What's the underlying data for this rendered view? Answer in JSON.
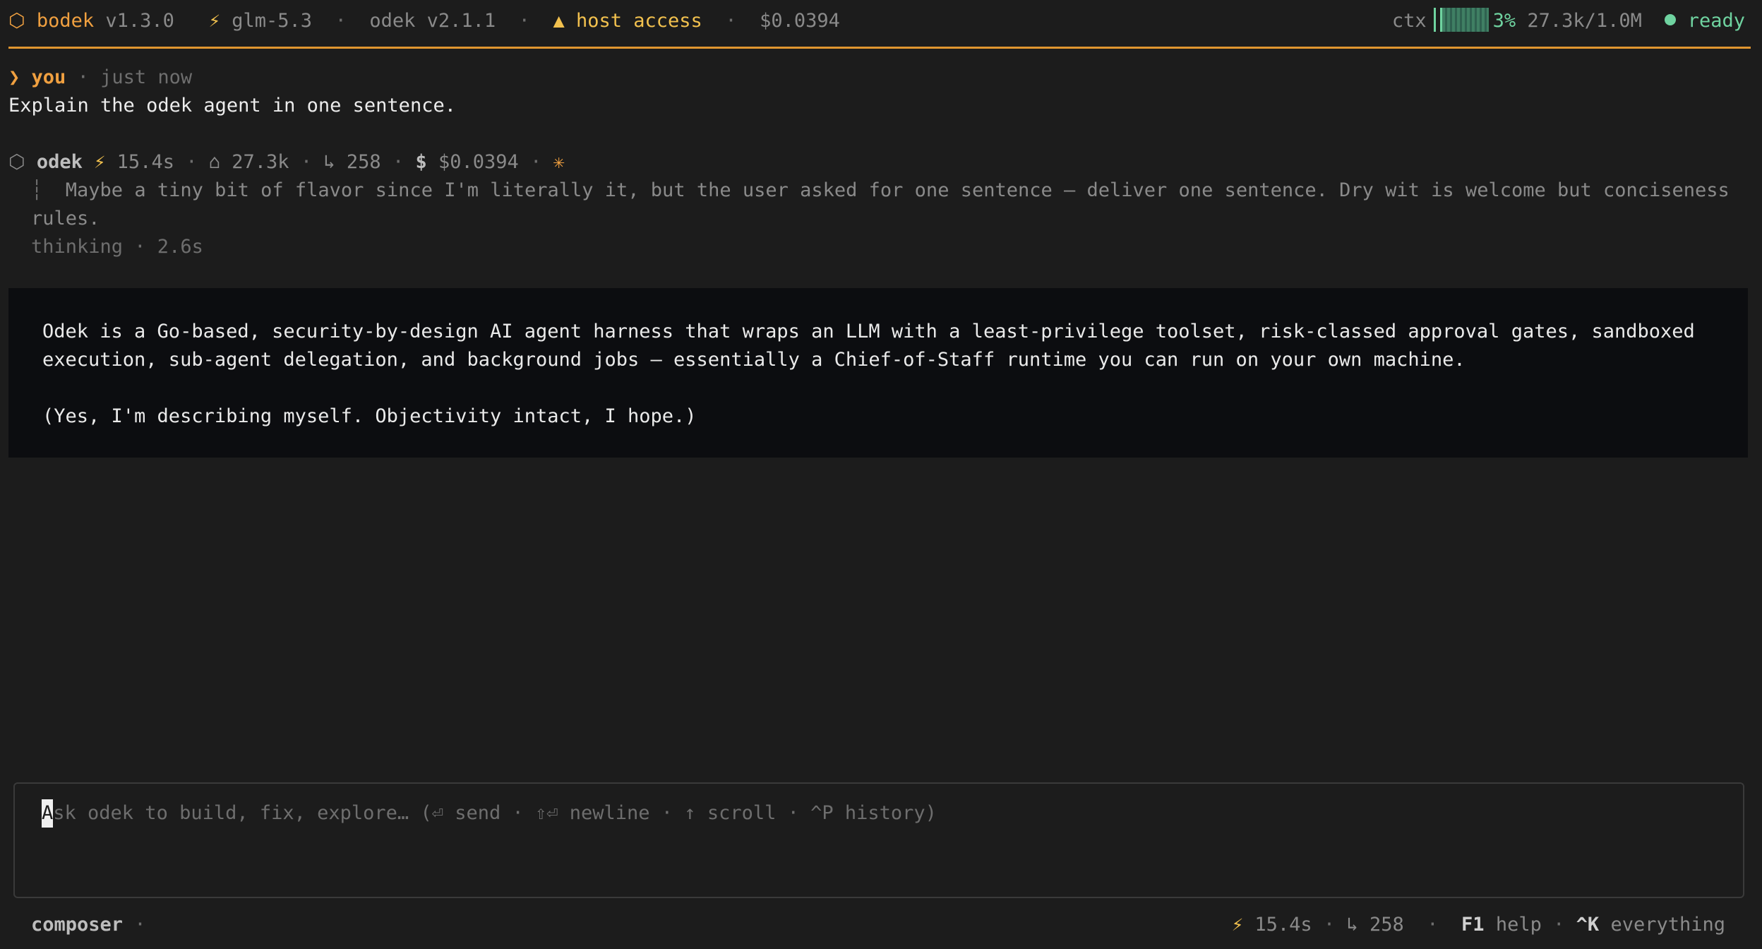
{
  "header": {
    "app_icon": "hexagon-icon",
    "app_name": "bodek",
    "app_version": "v1.3.0",
    "model_icon": "lightning-icon",
    "model": "glm-5.3",
    "agent_version": "odek v2.1.1",
    "warning_icon": "warning-triangle-icon",
    "host_access": "host access",
    "cost": "$0.0394",
    "ctx_label": "ctx",
    "ctx_percent": "3%",
    "ctx_fill_fraction": 0.03,
    "ctx_tokens": "27.3k/1.0M",
    "status": "ready"
  },
  "user_message": {
    "prompt_glyph": "❯",
    "author": "you",
    "time": "just now",
    "text": "Explain the odek agent in one sentence."
  },
  "agent_message": {
    "icon": "hexagon-icon",
    "author": "odek",
    "duration": "15.4s",
    "tokens_in": "27.3k",
    "tokens_out": "258",
    "cost": "$0.0394",
    "thinking_line_1": "Maybe a tiny bit of flavor since I'm literally it, but the user asked for one sentence — deliver one sentence. Dry wit is welcome but conciseness",
    "thinking_line_2": "rules.",
    "thinking_status": "thinking · 2.6s",
    "answer_line_1": "Odek is a Go-based, security-by-design AI agent harness that wraps an LLM with a least-privilege toolset, risk-classed approval gates, sandboxed",
    "answer_line_2": "execution, sub-agent delegation, and background jobs — essentially a Chief-of-Staff runtime you can run on your own machine.",
    "answer_line_3": "(Yes, I'm describing myself. Objectivity intact, I hope.)"
  },
  "composer": {
    "cursor_char": "A",
    "placeholder_rest": "sk odek to build, fix, explore… (⏎ send · ⇧⏎ newline · ↑ scroll · ^P history)"
  },
  "footer": {
    "mode": "composer",
    "duration": "15.4s",
    "tokens_out": "258",
    "help_key": "F1",
    "help_label": "help",
    "everything_key": "^K",
    "everything_label": "everything"
  }
}
